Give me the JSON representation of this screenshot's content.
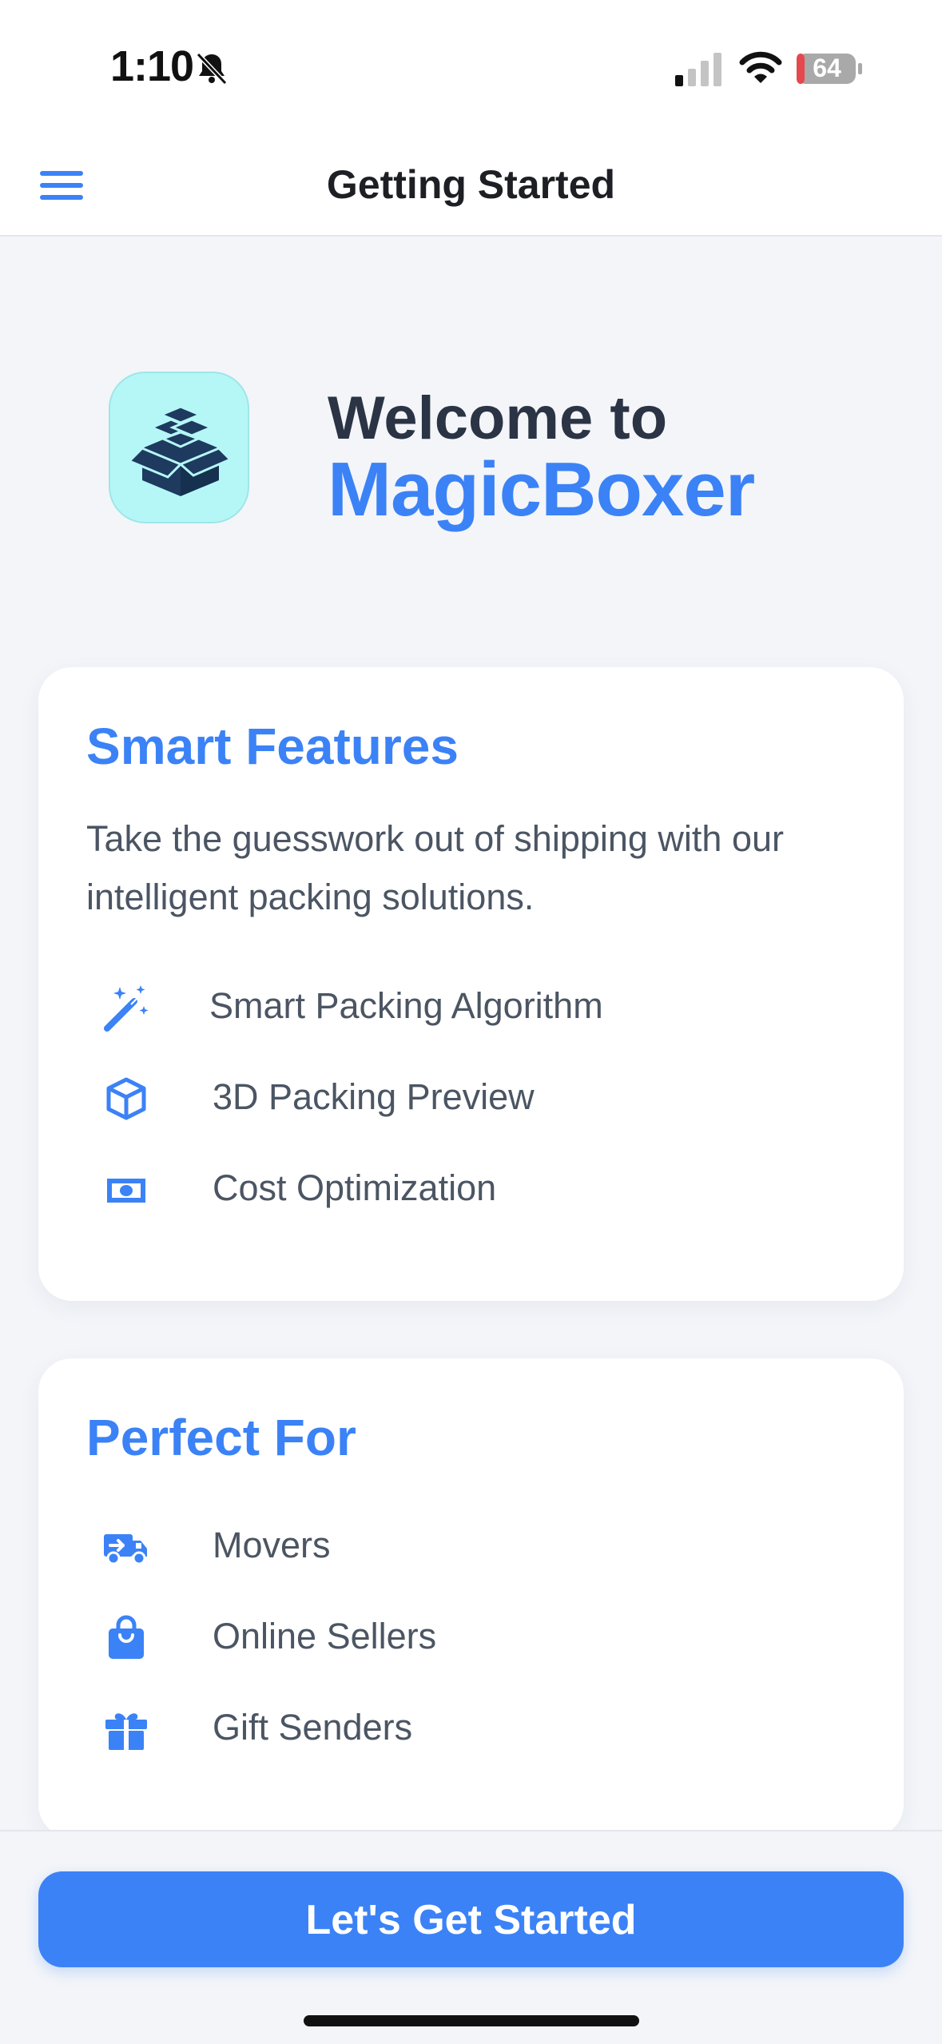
{
  "status_bar": {
    "time": "1:10",
    "battery": "64"
  },
  "nav": {
    "title": "Getting Started"
  },
  "hero": {
    "welcome": "Welcome to",
    "brand": "MagicBoxer"
  },
  "features_card": {
    "title": "Smart Features",
    "description": "Take the guesswork out of shipping with our intelligent packing solutions.",
    "items": [
      {
        "icon": "magic-wand-icon",
        "label": "Smart Packing Algorithm"
      },
      {
        "icon": "cube-icon",
        "label": "3D Packing Preview"
      },
      {
        "icon": "money-icon",
        "label": "Cost Optimization"
      }
    ]
  },
  "perfect_card": {
    "title": "Perfect For",
    "items": [
      {
        "icon": "truck-icon",
        "label": "Movers"
      },
      {
        "icon": "shopping-bag-icon",
        "label": "Online Sellers"
      },
      {
        "icon": "gift-icon",
        "label": "Gift Senders"
      }
    ]
  },
  "cta": {
    "label": "Let's Get Started"
  },
  "colors": {
    "accent": "#3b82f6",
    "logo_bg": "#b5f7f7",
    "background": "#f3f5f9"
  }
}
